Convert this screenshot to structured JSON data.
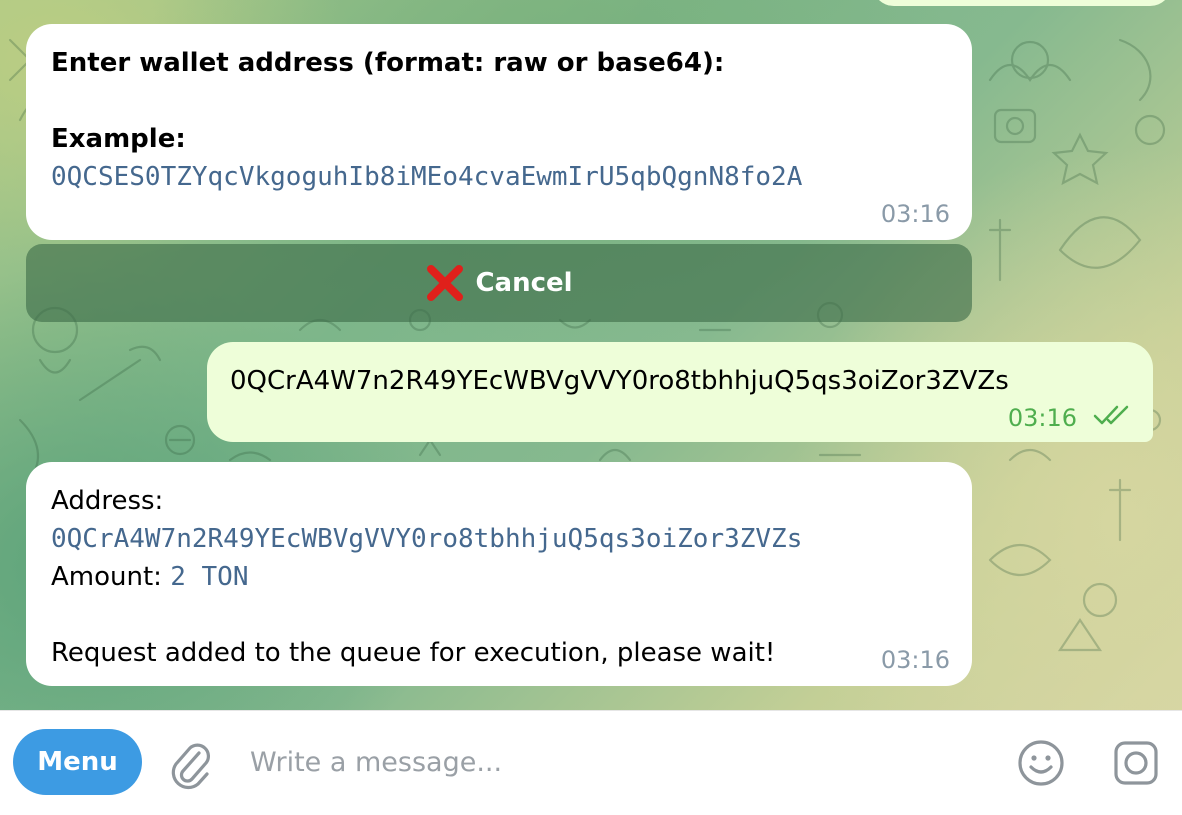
{
  "messages": {
    "m1": {
      "line1": "Enter wallet address (format: raw or base64):",
      "example_label": "Example:",
      "example_value": "0QCSES0TZYqcVkgoguhIb8iMEo4cvaEwmIrU5qbQgnN8fo2A",
      "time": "03:16"
    },
    "cancel": {
      "icon": "red-x-icon",
      "label": "Cancel"
    },
    "m2": {
      "text": "0QCrA4W7n2R49YEcWBVgVVY0ro8tbhhjuQ5qs3oiZor3ZVZs",
      "time": "03:16",
      "status": "double-check-icon"
    },
    "m3": {
      "address_label": "Address:",
      "address_value": "0QCrA4W7n2R49YEcWBVgVVY0ro8tbhhjuQ5qs3oiZor3ZVZs",
      "amount_label": "Amount:",
      "amount_value": "2 TON",
      "status_text": "Request added to the queue for execution, please wait!",
      "time": "03:16"
    }
  },
  "composer": {
    "menu_label": "Menu",
    "placeholder": "Write a message...",
    "icons": [
      "paperclip-icon",
      "emoji-icon",
      "camera-icon"
    ]
  },
  "colors": {
    "accent": "#3d9be3",
    "link_mono": "#45688e",
    "out_bubble": "#eefed9",
    "cancel_red": "#e0201b",
    "check_green": "#4fae4e"
  }
}
